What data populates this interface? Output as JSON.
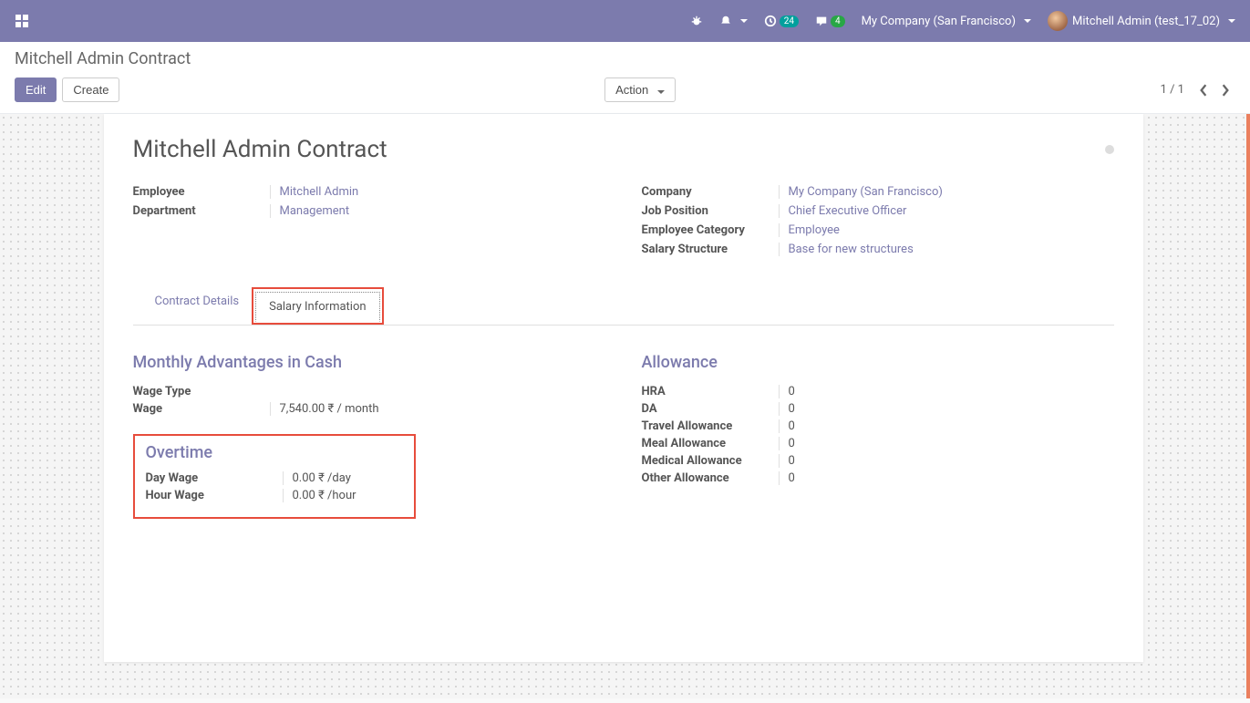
{
  "navbar": {
    "clock_badge": "24",
    "chat_badge": "4",
    "company": "My Company (San Francisco)",
    "user": "Mitchell Admin (test_17_02)"
  },
  "control": {
    "breadcrumb": "Mitchell Admin Contract",
    "edit": "Edit",
    "create": "Create",
    "action": "Action",
    "pager": "1 / 1"
  },
  "form": {
    "title": "Mitchell Admin Contract",
    "left": {
      "employee_label": "Employee",
      "employee_value": "Mitchell Admin",
      "department_label": "Department",
      "department_value": "Management"
    },
    "right": {
      "company_label": "Company",
      "company_value": "My Company (San Francisco)",
      "jobpos_label": "Job Position",
      "jobpos_value": "Chief Executive Officer",
      "empcat_label": "Employee Category",
      "empcat_value": "Employee",
      "salstruct_label": "Salary Structure",
      "salstruct_value": "Base for new structures"
    },
    "tabs": {
      "contract_details": "Contract Details",
      "salary_info": "Salary Information"
    },
    "monthly": {
      "title": "Monthly Advantages in Cash",
      "wage_type_label": "Wage Type",
      "wage_label": "Wage",
      "wage_value": "7,540.00 ₹  / month"
    },
    "allowance": {
      "title": "Allowance",
      "hra_label": "HRA",
      "hra_value": "0",
      "da_label": "DA",
      "da_value": "0",
      "travel_label": "Travel Allowance",
      "travel_value": "0",
      "meal_label": "Meal Allowance",
      "meal_value": "0",
      "medical_label": "Medical Allowance",
      "medical_value": "0",
      "other_label": "Other Allowance",
      "other_value": "0"
    },
    "overtime": {
      "title": "Overtime",
      "day_label": "Day Wage",
      "day_value": "0.00 ₹  /day",
      "hour_label": "Hour Wage",
      "hour_value": "0.00 ₹  /hour"
    }
  }
}
